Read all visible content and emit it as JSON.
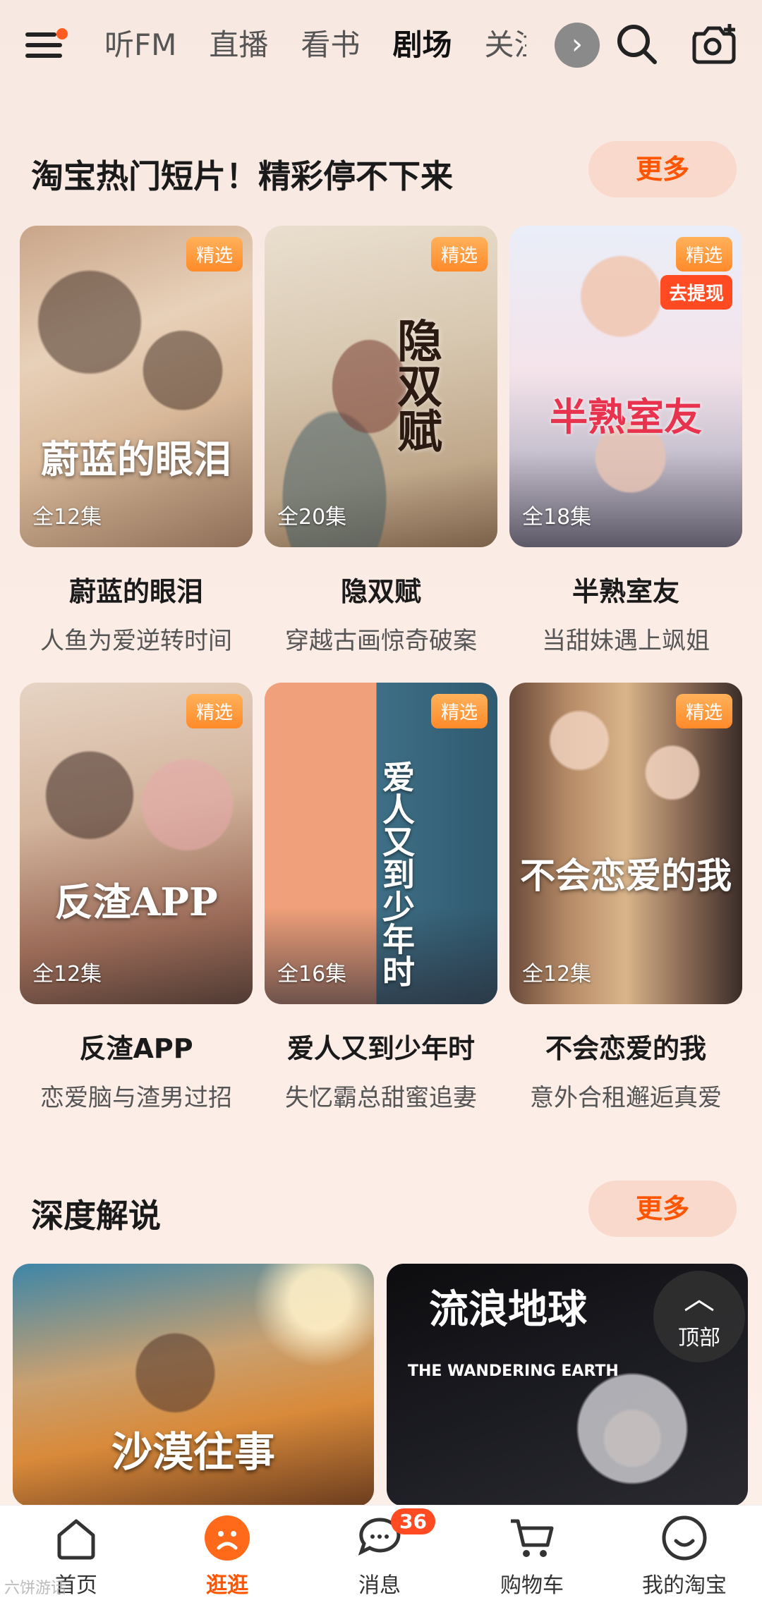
{
  "top_nav": {
    "tabs": [
      "听FM",
      "直播",
      "看书",
      "剧场",
      "关注"
    ],
    "active_tab": "剧场",
    "more_icon": "chevron-right-icon",
    "search_icon": "search-icon",
    "camera_icon": "camera-scan-icon"
  },
  "section_short": {
    "title": "淘宝热门短片！精彩停不下来",
    "more_label": "更多",
    "cards": [
      {
        "name": "蔚蓝的眼泪",
        "desc": "人鱼为爱逆转时间",
        "episodes": "全12集",
        "badge": "精选",
        "poster_title": "蔚蓝的眼泪"
      },
      {
        "name": "隐双赋",
        "desc": "穿越古画惊奇破案",
        "episodes": "全20集",
        "badge": "精选",
        "poster_title": "隐双赋"
      },
      {
        "name": "半熟室友",
        "desc": "当甜妹遇上飒姐",
        "episodes": "全18集",
        "badge": "精选",
        "badge2": "去提现",
        "poster_title": "半熟室友"
      },
      {
        "name": "反渣APP",
        "desc": "恋爱脑与渣男过招",
        "episodes": "全12集",
        "badge": "精选",
        "poster_title": "反渣APP"
      },
      {
        "name": "爱人又到少年时",
        "desc": "失忆霸总甜蜜追妻",
        "episodes": "全16集",
        "badge": "精选",
        "poster_title": "爱人又到少年时"
      },
      {
        "name": "不会恋爱的我",
        "desc": "意外合租邂逅真爱",
        "episodes": "全12集",
        "badge": "精选",
        "poster_title": "不会恋爱的我"
      }
    ]
  },
  "section_explain": {
    "title": "深度解说",
    "more_label": "更多",
    "cards": [
      {
        "poster_title": "沙漠往事"
      },
      {
        "poster_title": "流浪地球",
        "poster_subtitle": "THE WANDERING EARTH"
      }
    ]
  },
  "back_to_top": {
    "label": "顶部",
    "icon": "chevron-up-icon"
  },
  "bottom_nav": {
    "items": [
      {
        "label": "首页",
        "icon": "home-icon"
      },
      {
        "label": "逛逛",
        "icon": "guangguang-icon"
      },
      {
        "label": "消息",
        "icon": "message-icon",
        "badge": "36"
      },
      {
        "label": "购物车",
        "icon": "cart-icon"
      },
      {
        "label": "我的淘宝",
        "icon": "profile-icon"
      }
    ],
    "active": "逛逛"
  },
  "watermark": "六饼游话",
  "colors": {
    "accent": "#ff5500",
    "badge_red": "#ff4a22",
    "background": "#f9ebe4"
  }
}
